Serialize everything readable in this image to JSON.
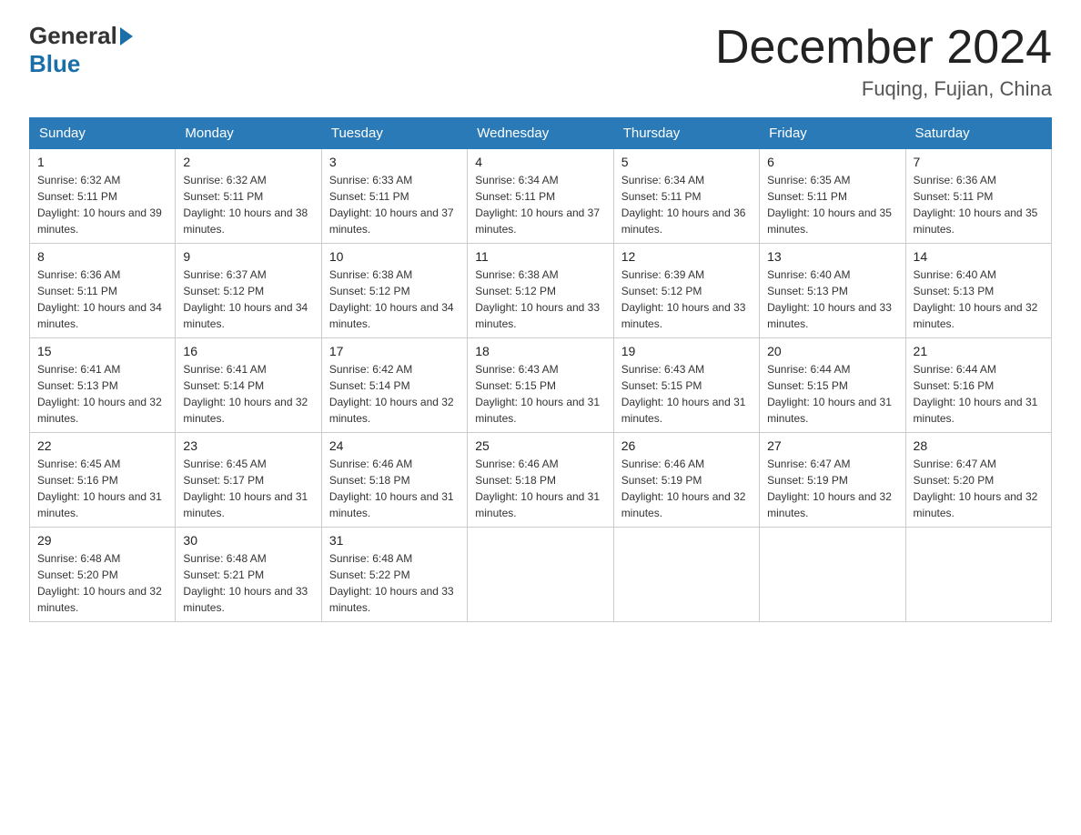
{
  "header": {
    "logo_text_general": "General",
    "logo_text_blue": "Blue",
    "month_title": "December 2024",
    "location": "Fuqing, Fujian, China"
  },
  "days_of_week": [
    "Sunday",
    "Monday",
    "Tuesday",
    "Wednesday",
    "Thursday",
    "Friday",
    "Saturday"
  ],
  "weeks": [
    [
      {
        "day": "1",
        "sunrise": "6:32 AM",
        "sunset": "5:11 PM",
        "daylight": "10 hours and 39 minutes."
      },
      {
        "day": "2",
        "sunrise": "6:32 AM",
        "sunset": "5:11 PM",
        "daylight": "10 hours and 38 minutes."
      },
      {
        "day": "3",
        "sunrise": "6:33 AM",
        "sunset": "5:11 PM",
        "daylight": "10 hours and 37 minutes."
      },
      {
        "day": "4",
        "sunrise": "6:34 AM",
        "sunset": "5:11 PM",
        "daylight": "10 hours and 37 minutes."
      },
      {
        "day": "5",
        "sunrise": "6:34 AM",
        "sunset": "5:11 PM",
        "daylight": "10 hours and 36 minutes."
      },
      {
        "day": "6",
        "sunrise": "6:35 AM",
        "sunset": "5:11 PM",
        "daylight": "10 hours and 35 minutes."
      },
      {
        "day": "7",
        "sunrise": "6:36 AM",
        "sunset": "5:11 PM",
        "daylight": "10 hours and 35 minutes."
      }
    ],
    [
      {
        "day": "8",
        "sunrise": "6:36 AM",
        "sunset": "5:11 PM",
        "daylight": "10 hours and 34 minutes."
      },
      {
        "day": "9",
        "sunrise": "6:37 AM",
        "sunset": "5:12 PM",
        "daylight": "10 hours and 34 minutes."
      },
      {
        "day": "10",
        "sunrise": "6:38 AM",
        "sunset": "5:12 PM",
        "daylight": "10 hours and 34 minutes."
      },
      {
        "day": "11",
        "sunrise": "6:38 AM",
        "sunset": "5:12 PM",
        "daylight": "10 hours and 33 minutes."
      },
      {
        "day": "12",
        "sunrise": "6:39 AM",
        "sunset": "5:12 PM",
        "daylight": "10 hours and 33 minutes."
      },
      {
        "day": "13",
        "sunrise": "6:40 AM",
        "sunset": "5:13 PM",
        "daylight": "10 hours and 33 minutes."
      },
      {
        "day": "14",
        "sunrise": "6:40 AM",
        "sunset": "5:13 PM",
        "daylight": "10 hours and 32 minutes."
      }
    ],
    [
      {
        "day": "15",
        "sunrise": "6:41 AM",
        "sunset": "5:13 PM",
        "daylight": "10 hours and 32 minutes."
      },
      {
        "day": "16",
        "sunrise": "6:41 AM",
        "sunset": "5:14 PM",
        "daylight": "10 hours and 32 minutes."
      },
      {
        "day": "17",
        "sunrise": "6:42 AM",
        "sunset": "5:14 PM",
        "daylight": "10 hours and 32 minutes."
      },
      {
        "day": "18",
        "sunrise": "6:43 AM",
        "sunset": "5:15 PM",
        "daylight": "10 hours and 31 minutes."
      },
      {
        "day": "19",
        "sunrise": "6:43 AM",
        "sunset": "5:15 PM",
        "daylight": "10 hours and 31 minutes."
      },
      {
        "day": "20",
        "sunrise": "6:44 AM",
        "sunset": "5:15 PM",
        "daylight": "10 hours and 31 minutes."
      },
      {
        "day": "21",
        "sunrise": "6:44 AM",
        "sunset": "5:16 PM",
        "daylight": "10 hours and 31 minutes."
      }
    ],
    [
      {
        "day": "22",
        "sunrise": "6:45 AM",
        "sunset": "5:16 PM",
        "daylight": "10 hours and 31 minutes."
      },
      {
        "day": "23",
        "sunrise": "6:45 AM",
        "sunset": "5:17 PM",
        "daylight": "10 hours and 31 minutes."
      },
      {
        "day": "24",
        "sunrise": "6:46 AM",
        "sunset": "5:18 PM",
        "daylight": "10 hours and 31 minutes."
      },
      {
        "day": "25",
        "sunrise": "6:46 AM",
        "sunset": "5:18 PM",
        "daylight": "10 hours and 31 minutes."
      },
      {
        "day": "26",
        "sunrise": "6:46 AM",
        "sunset": "5:19 PM",
        "daylight": "10 hours and 32 minutes."
      },
      {
        "day": "27",
        "sunrise": "6:47 AM",
        "sunset": "5:19 PM",
        "daylight": "10 hours and 32 minutes."
      },
      {
        "day": "28",
        "sunrise": "6:47 AM",
        "sunset": "5:20 PM",
        "daylight": "10 hours and 32 minutes."
      }
    ],
    [
      {
        "day": "29",
        "sunrise": "6:48 AM",
        "sunset": "5:20 PM",
        "daylight": "10 hours and 32 minutes."
      },
      {
        "day": "30",
        "sunrise": "6:48 AM",
        "sunset": "5:21 PM",
        "daylight": "10 hours and 33 minutes."
      },
      {
        "day": "31",
        "sunrise": "6:48 AM",
        "sunset": "5:22 PM",
        "daylight": "10 hours and 33 minutes."
      },
      null,
      null,
      null,
      null
    ]
  ],
  "labels": {
    "sunrise_prefix": "Sunrise: ",
    "sunset_prefix": "Sunset: ",
    "daylight_prefix": "Daylight: "
  }
}
